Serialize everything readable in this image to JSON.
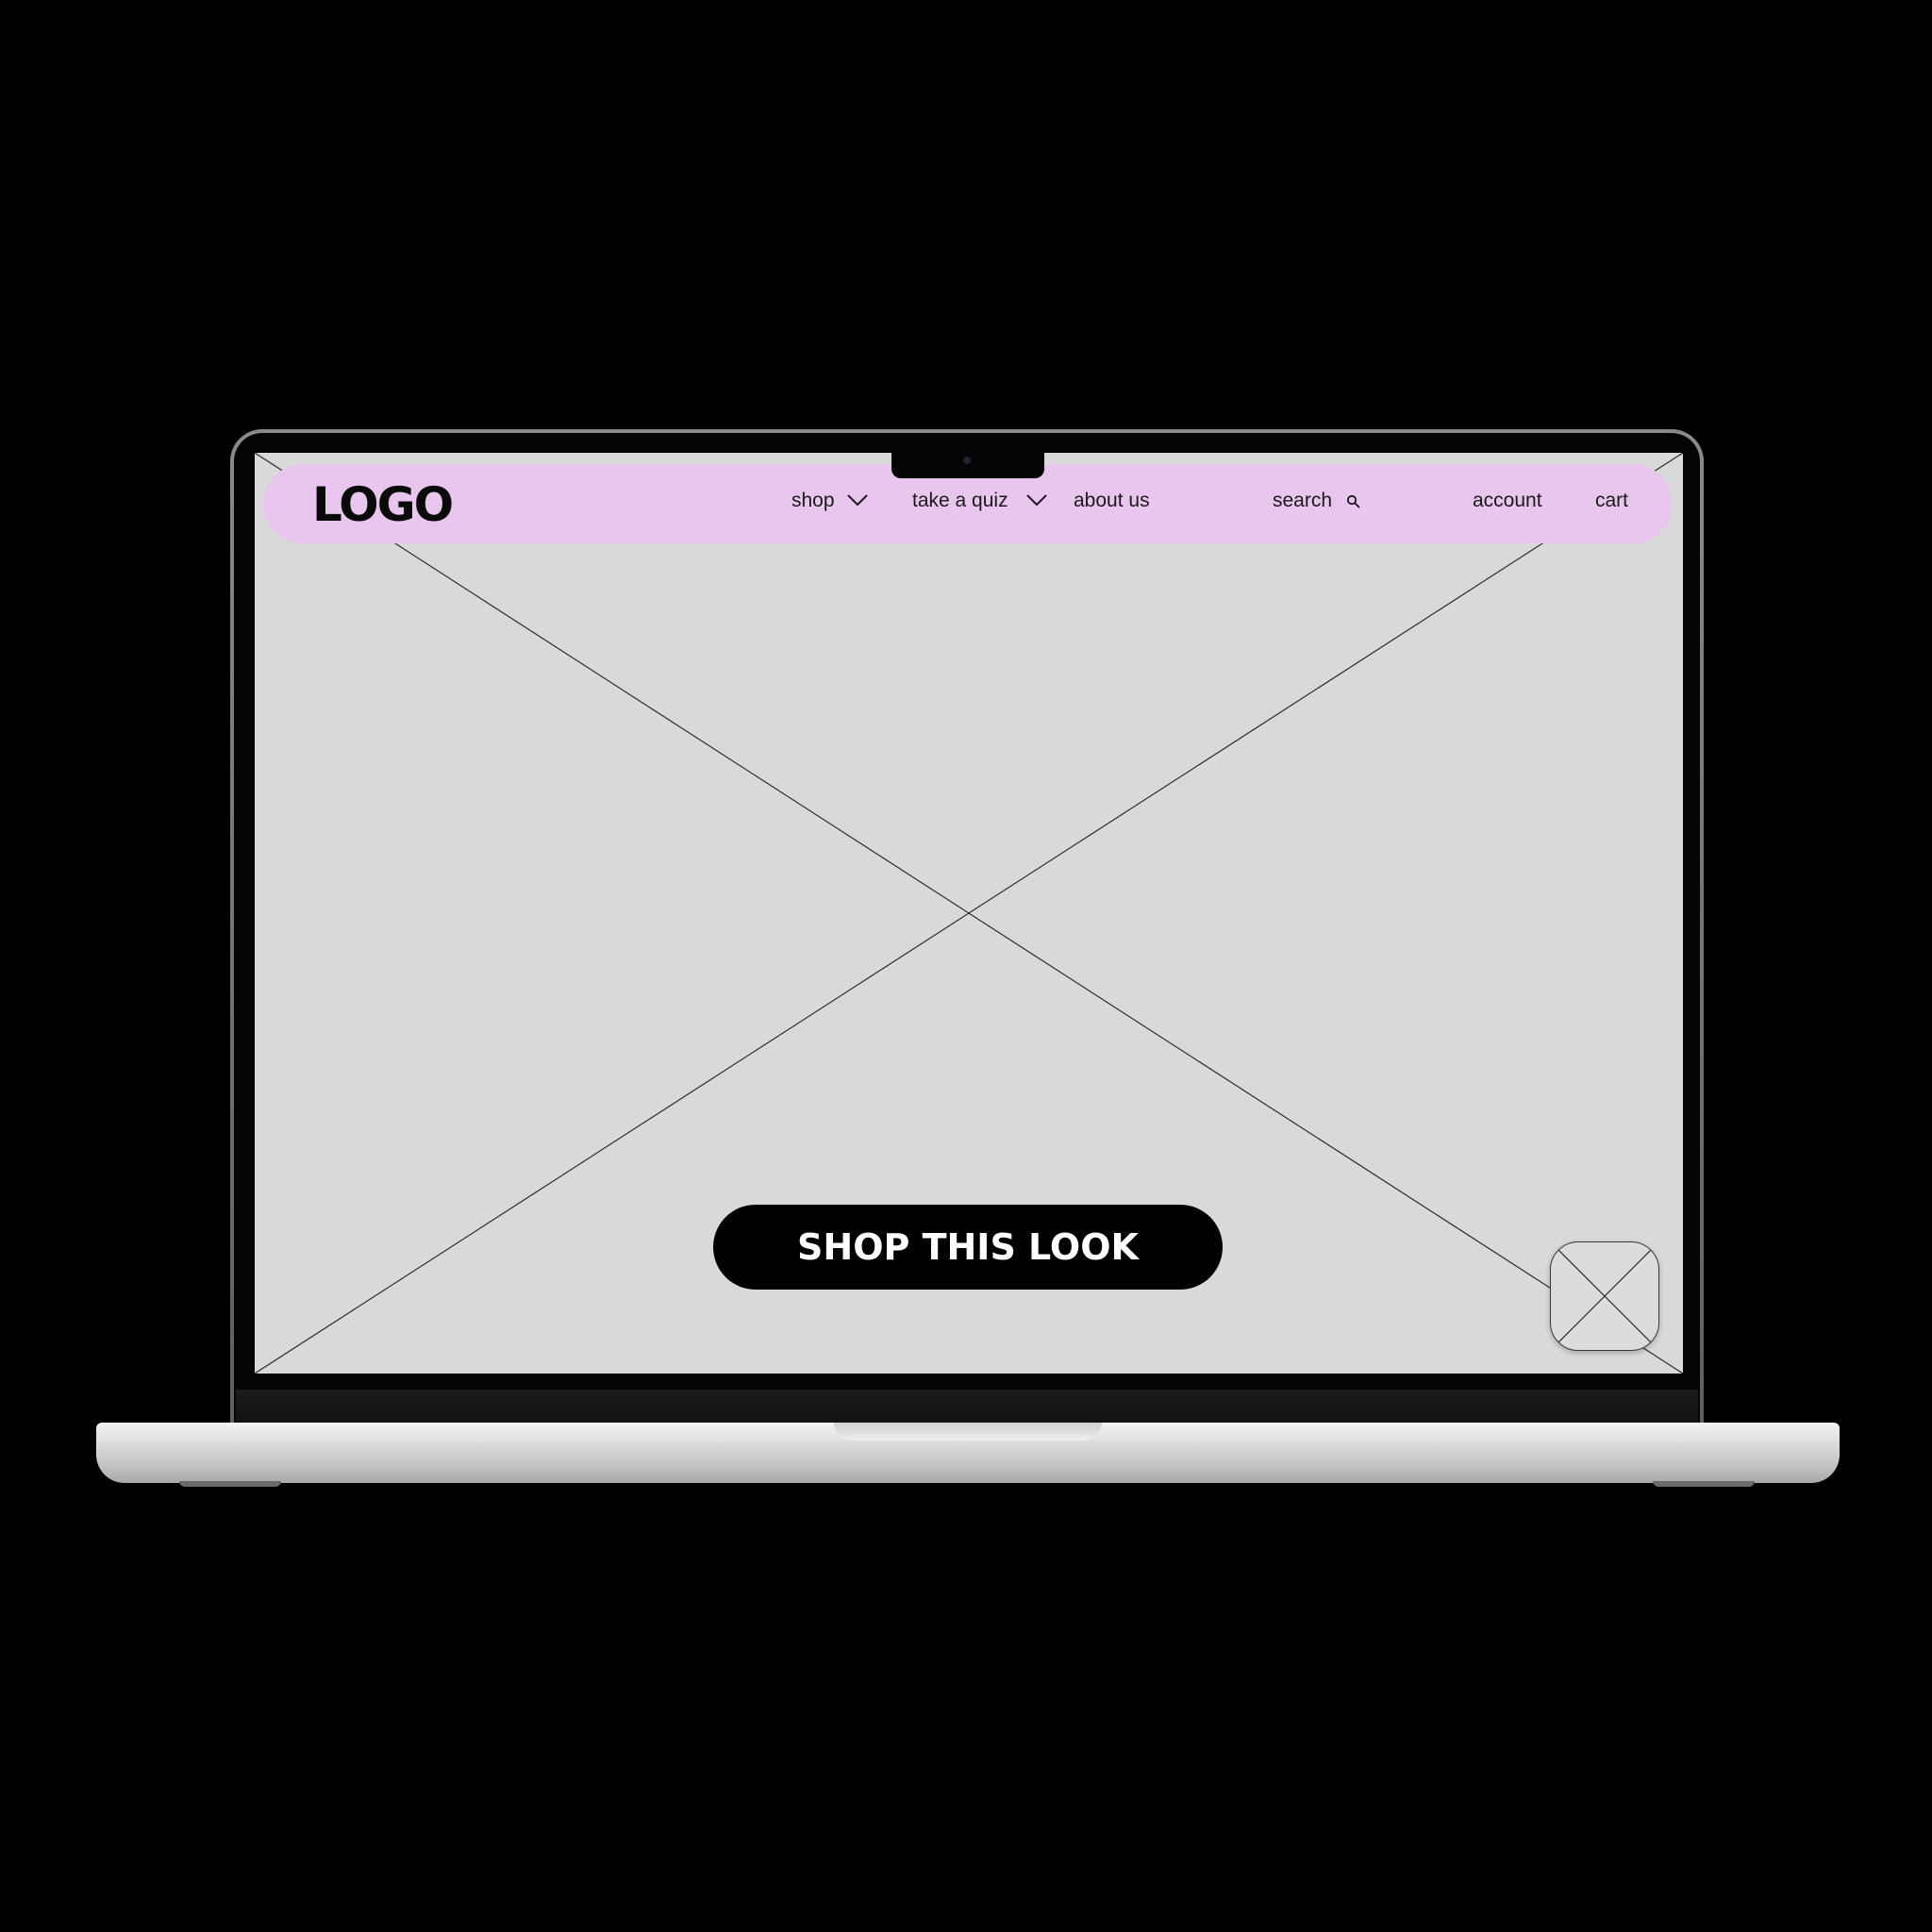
{
  "logo": {
    "text": "LOGO"
  },
  "nav": {
    "shop_label": "shop",
    "quiz_label": "take a quiz",
    "about_label": "about us",
    "search_label": "search",
    "account_label": "account",
    "cart_label": "cart"
  },
  "hero": {
    "cta_label": "SHOP THIS LOOK"
  },
  "icons": {
    "shop_chevron": "chevron-down-icon",
    "quiz_chevron": "chevron-down-icon",
    "search": "search-icon"
  },
  "colors": {
    "navbar": "#e9c6ee",
    "screen": "#d9d9d9",
    "cta_background": "#000000",
    "cta_text": "#ffffff"
  }
}
